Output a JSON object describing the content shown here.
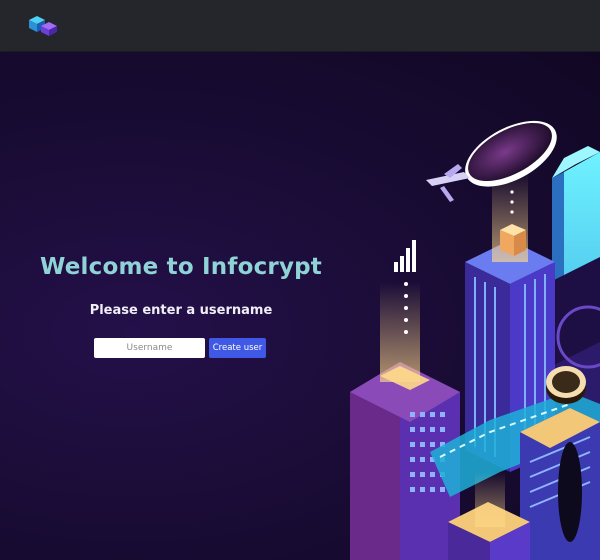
{
  "header": {
    "logo_icon": "cube-logo-icon"
  },
  "main": {
    "title": "Welcome to Infocrypt",
    "subtitle": "Please enter a username",
    "username_placeholder": "Username",
    "create_button_label": "Create user"
  },
  "illustration": {
    "icon": "isometric-city-illustration"
  },
  "colors": {
    "header_bg": "#25262c",
    "page_bg": "#14092a",
    "title": "#8fd3d6",
    "button": "#3f59e6"
  }
}
